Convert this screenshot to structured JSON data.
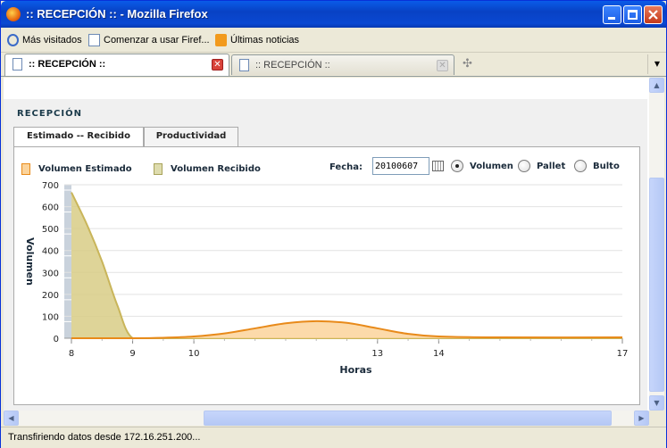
{
  "window": {
    "title": ":: RECEPCIÓN :: - Mozilla Firefox",
    "colors": {
      "titlebar": "#0a48d2",
      "close_button": "#c4391a"
    }
  },
  "bookmarks": [
    {
      "label": "Más visitados",
      "icon": "search-icon"
    },
    {
      "label": "Comenzar a usar Firef...",
      "icon": "page-icon"
    },
    {
      "label": "Últimas noticias",
      "icon": "rss-icon"
    }
  ],
  "tabs": [
    {
      "label": ":: RECEPCIÓN ::",
      "active": true
    },
    {
      "label": ":: RECEPCIÓN ::",
      "active": false
    }
  ],
  "page": {
    "section_title": "RECEPCIÓN",
    "panel_tabs": [
      {
        "label": "Estimado -- Recibido",
        "active": true
      },
      {
        "label": "Productividad",
        "active": false
      }
    ],
    "legend": [
      {
        "label": "Volumen Estimado",
        "color": "#f5a623"
      },
      {
        "label": "Volumen Recibido",
        "color": "#d4d08a"
      }
    ],
    "fecha_label": "Fecha:",
    "fecha_value": "20100607",
    "radios": [
      {
        "label": "Volumen",
        "selected": true
      },
      {
        "label": "Pallet",
        "selected": false
      },
      {
        "label": "Bulto",
        "selected": false
      }
    ]
  },
  "chart_data": {
    "type": "area",
    "xlabel": "Horas",
    "ylabel": "Volumen",
    "xlim": [
      8,
      17
    ],
    "ylim": [
      0,
      700
    ],
    "x_ticks": [
      "8",
      "9",
      "10",
      "13",
      "14",
      "17"
    ],
    "y_ticks": [
      "0",
      "100",
      "200",
      "300",
      "400",
      "500",
      "600",
      "700"
    ],
    "series": [
      {
        "name": "Volumen Recibido",
        "color": "#c9b55a",
        "points": [
          {
            "x": 8,
            "y": 665
          },
          {
            "x": 8.25,
            "y": 520
          },
          {
            "x": 8.5,
            "y": 350
          },
          {
            "x": 8.75,
            "y": 150
          },
          {
            "x": 9,
            "y": 0
          },
          {
            "x": 9.5,
            "y": 0
          },
          {
            "x": 17,
            "y": 0
          }
        ]
      },
      {
        "name": "Volumen Estimado",
        "color": "#e88a1a",
        "points": [
          {
            "x": 8,
            "y": 0
          },
          {
            "x": 9,
            "y": 0
          },
          {
            "x": 9.5,
            "y": 2
          },
          {
            "x": 10,
            "y": 8
          },
          {
            "x": 10.5,
            "y": 22
          },
          {
            "x": 11,
            "y": 45
          },
          {
            "x": 11.5,
            "y": 68
          },
          {
            "x": 12,
            "y": 78
          },
          {
            "x": 12.5,
            "y": 70
          },
          {
            "x": 13,
            "y": 45
          },
          {
            "x": 13.5,
            "y": 20
          },
          {
            "x": 14,
            "y": 8
          },
          {
            "x": 15,
            "y": 4
          },
          {
            "x": 17,
            "y": 4
          }
        ]
      }
    ]
  },
  "status": "Transfiriendo datos desde 172.16.251.200..."
}
